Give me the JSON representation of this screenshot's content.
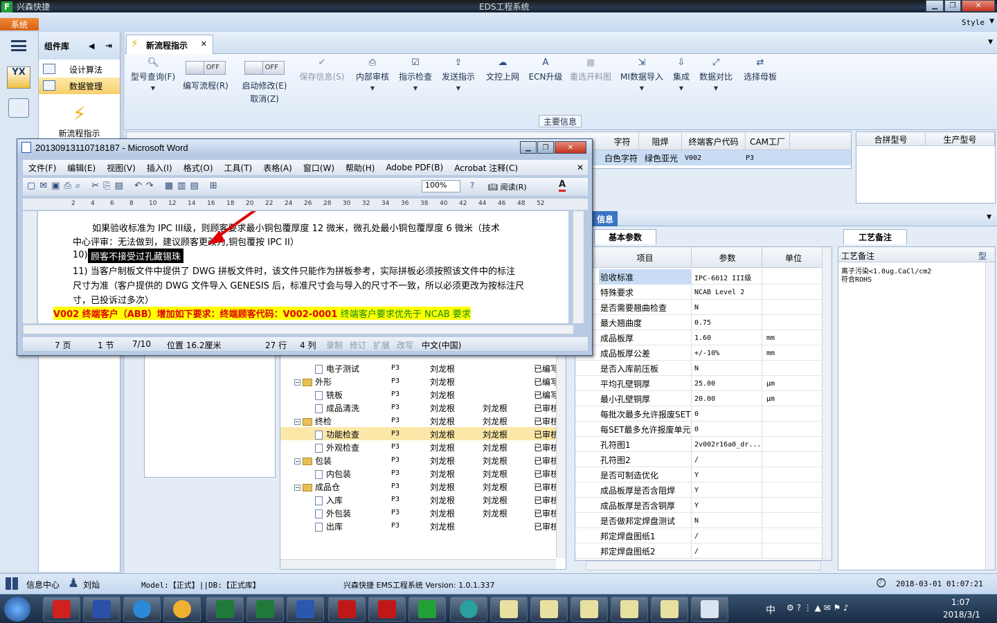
{
  "app": {
    "name": "兴森快捷",
    "window_title": "EDS工程系统",
    "system_button": "系统",
    "style_label": "Style",
    "logo_letter": "F"
  },
  "sidebar": {
    "title": "组件库",
    "items": [
      {
        "label": "设计算法"
      },
      {
        "label": "数据管理"
      }
    ],
    "big_button_label": "新流程指示",
    "strip_icon_text": "YX"
  },
  "tabs": [
    {
      "label": "新流程指示"
    }
  ],
  "toolbar": {
    "type_query": "型号查询(F)",
    "edit_flow_toggle": "OFF",
    "edit_flow": "编写流程(R)",
    "modify_toggle": "OFF",
    "modify_line1": "启动修改(E)",
    "modify_line2": "取消(Z)",
    "save_info": "保存信息(S)",
    "internal_review": "内部审核",
    "instruction_check": "指示检查",
    "send_instruction": "发送指示",
    "doc_upload": "文控上网",
    "ecn_upgrade": "ECN升级",
    "reselect_material": "重选开料图",
    "mi_import": "MI数据导入",
    "integrate": "集成",
    "data_compare": "数据对比",
    "select_master": "选择母板"
  },
  "main_info_label": "主要信息",
  "grid": {
    "headers": [
      "字符",
      "阻焊",
      "终端客户代码",
      "CAM工厂"
    ],
    "row": [
      "白色字符",
      "绿色亚光",
      "V002",
      "P3"
    ],
    "right_headers": [
      "合拼型号",
      "生产型号"
    ]
  },
  "tree": {
    "rows": [
      {
        "name": "电子测试",
        "indent": 2,
        "type": "doc",
        "factory": "P3",
        "creator": "刘龙根",
        "reviewer": "",
        "status": "已编写"
      },
      {
        "name": "外形",
        "indent": 1,
        "type": "folder",
        "factory": "P3",
        "creator": "刘龙根",
        "reviewer": "",
        "status": "已编写"
      },
      {
        "name": "铣板",
        "indent": 2,
        "type": "doc",
        "factory": "P3",
        "creator": "刘龙根",
        "reviewer": "",
        "status": "已编写"
      },
      {
        "name": "成品清洗",
        "indent": 2,
        "type": "doc",
        "factory": "P3",
        "creator": "刘龙根",
        "reviewer": "刘龙根",
        "status": "已审核"
      },
      {
        "name": "终检",
        "indent": 1,
        "type": "folder",
        "factory": "P3",
        "creator": "刘龙根",
        "reviewer": "刘龙根",
        "status": "已审核"
      },
      {
        "name": "功能检查",
        "indent": 2,
        "type": "doc",
        "factory": "P3",
        "creator": "刘龙根",
        "reviewer": "刘龙根",
        "status": "已审核",
        "selected": true
      },
      {
        "name": "外观检查",
        "indent": 2,
        "type": "doc",
        "factory": "P3",
        "creator": "刘龙根",
        "reviewer": "刘龙根",
        "status": "已审核"
      },
      {
        "name": "包装",
        "indent": 1,
        "type": "folder",
        "factory": "P3",
        "creator": "刘龙根",
        "reviewer": "刘龙根",
        "status": "已审核"
      },
      {
        "name": "内包装",
        "indent": 2,
        "type": "doc",
        "factory": "P3",
        "creator": "刘龙根",
        "reviewer": "刘龙根",
        "status": "已审核"
      },
      {
        "name": "成品仓",
        "indent": 1,
        "type": "folder",
        "factory": "P3",
        "creator": "刘龙根",
        "reviewer": "刘龙根",
        "status": "已审核"
      },
      {
        "name": "入库",
        "indent": 2,
        "type": "doc",
        "factory": "P3",
        "creator": "刘龙根",
        "reviewer": "刘龙根",
        "status": "已审核"
      },
      {
        "name": "外包装",
        "indent": 2,
        "type": "doc",
        "factory": "P3",
        "creator": "刘龙根",
        "reviewer": "刘龙根",
        "status": "已审核"
      },
      {
        "name": "出库",
        "indent": 2,
        "type": "doc",
        "factory": "P3",
        "creator": "刘龙根",
        "reviewer": "",
        "status": "已审核"
      }
    ]
  },
  "info": {
    "tab_label": "信息",
    "basic_tab": "基本参数",
    "headers": [
      "项目",
      "参数",
      "单位"
    ],
    "rows": [
      {
        "k": "验收标准",
        "v": "IPC-6012 III级",
        "u": "",
        "selected": true
      },
      {
        "k": "特殊要求",
        "v": "NCAB Level 2",
        "u": ""
      },
      {
        "k": "是否需要翘曲检查",
        "v": "N",
        "u": ""
      },
      {
        "k": "最大翘曲度",
        "v": "0.75",
        "u": ""
      },
      {
        "k": "成品板厚",
        "v": "1.60",
        "u": "mm"
      },
      {
        "k": "成品板厚公差",
        "v": "+/-10%",
        "u": "mm"
      },
      {
        "k": "是否入库前压板",
        "v": "N",
        "u": ""
      },
      {
        "k": "平均孔壁铜厚",
        "v": "25.00",
        "u": "μm"
      },
      {
        "k": "最小孔壁铜厚",
        "v": "20.00",
        "u": "μm"
      },
      {
        "k": "每批次最多允许报废SET",
        "v": "0",
        "u": ""
      },
      {
        "k": "每SET最多允许报废单元",
        "v": "0",
        "u": ""
      },
      {
        "k": "孔符图1",
        "v": "2v002r16a0_dr...",
        "u": ""
      },
      {
        "k": "孔符图2",
        "v": "/",
        "u": ""
      },
      {
        "k": "是否可制造优化",
        "v": "Y",
        "u": ""
      },
      {
        "k": "成品板厚是否含阻焊",
        "v": "Y",
        "u": ""
      },
      {
        "k": "成品板厚是否含铜厚",
        "v": "Y",
        "u": ""
      },
      {
        "k": "是否做邦定焊盘测试",
        "v": "N",
        "u": ""
      },
      {
        "k": "邦定焊盘图纸1",
        "v": "/",
        "u": ""
      },
      {
        "k": "邦定焊盘图纸2",
        "v": "/",
        "u": ""
      }
    ]
  },
  "craft": {
    "tab": "工艺备注",
    "header": "工艺备注",
    "header2": "型",
    "note_line1": "离子污染<1.0ug.CaCl/cm2",
    "note_line2": "符合ROHS"
  },
  "word": {
    "title": "20130913110718187 - Microsoft Word",
    "menu": [
      "文件(F)",
      "编辑(E)",
      "视图(V)",
      "插入(I)",
      "格式(O)",
      "工具(T)",
      "表格(A)",
      "窗口(W)",
      "帮助(H)",
      "Adobe PDF(B)",
      "Acrobat 注释(C)"
    ],
    "zoom": "100%",
    "reading_btn": "阅读(R)",
    "ruler": [
      "2",
      "4",
      "6",
      "8",
      "10",
      "12",
      "14",
      "16",
      "18",
      "20",
      "22",
      "24",
      "26",
      "28",
      "30",
      "32",
      "34",
      "36",
      "38",
      "40",
      "42",
      "44",
      "46",
      "48",
      "52"
    ],
    "doc": {
      "line1": "如果验收标准为 IPC III级，则顾客要求最小铜包覆厚度 12 微米，微孔处最小铜包覆厚度 6 微米（技术",
      "line2": "中心评审：无法做到，建议顾客更改为,铜包覆按 IPC II）",
      "line3_num": "10)",
      "line3_sel": "顾客不接受过孔藏锡珠",
      "line4": "11) 当客户制板文件中提供了 DWG 拼板文件时，该文件只能作为拼板参考，实际拼板必须按照该文件中的标注",
      "line5": "尺寸为准（客户提供的 DWG 文件导入 GENESIS 后，标准尺寸会与导入的尺寸不一致，所以必须更改为按标注尺",
      "line6": "寸，已投诉过多次）",
      "line7a": "V002 终端客户（ABB）增加如下要求：终端顾客代码：V002-0001 ",
      "line7b": "终端客户要求优先于 NCAB 要求"
    },
    "status": {
      "page": "7 页",
      "section": "1 节",
      "pages": "7/10",
      "position": "位置 16.2厘米",
      "row": "27 行",
      "col": "4 列",
      "rec": "录制",
      "trk": "修订",
      "ext": "扩展",
      "ovr": "改写",
      "lang": "中文(中国)"
    }
  },
  "statusbar": {
    "info_center": "信息中心",
    "user": "刘灿",
    "model": "Model:【正式】||DB:【正式库】",
    "app_info": "兴森快捷 EMS工程系统 Version: 1.0.1.337",
    "datetime": "2018-03-01 01:07:21"
  },
  "taskbar": {
    "time": "1:07",
    "date": "2018/3/1",
    "tray_text": "中"
  }
}
